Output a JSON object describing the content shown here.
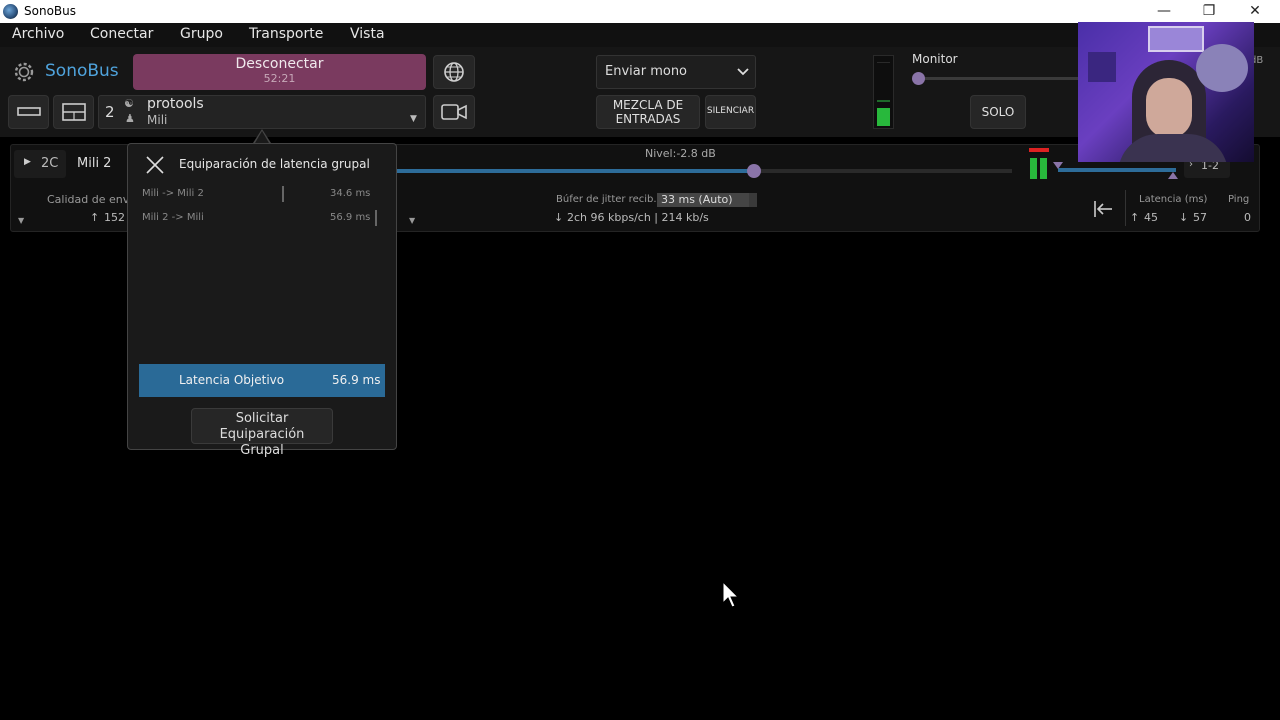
{
  "window": {
    "title": "SonoBus"
  },
  "menu": [
    "Archivo",
    "Conectar",
    "Grupo",
    "Transporte",
    "Vista"
  ],
  "toolbar": {
    "brand": "SonoBus",
    "disconnect_label": "Desconectar",
    "elapsed": "52:21",
    "group_count": "2",
    "group_name": "protools",
    "user_name": "Mili",
    "send_mode": "Enviar mono",
    "mix_inputs_line1": "MEZCLA DE",
    "mix_inputs_line2": "ENTRADAS",
    "mute_label": "SILENCIAR",
    "monitor_label": "Monitor",
    "solo_label": "SOLO",
    "db_partial": "dB"
  },
  "strip": {
    "channels": "2C",
    "peer_name": "Mili 2",
    "level_label": "Nivel:-2.8 dB",
    "level_fraction": 0.58,
    "output_label": "1-2",
    "send_quality_label": "Calidad de envi",
    "send_up": "152",
    "jitter_label": "Búfer de jitter recib.",
    "jitter_value": "33 ms (Auto)",
    "stream_info": "2ch 96 kbps/ch | 214 kb/s",
    "latency_label": "Latencia (ms)",
    "latency_up": "45",
    "latency_down": "57",
    "ping_label": "Ping",
    "ping_value": "0"
  },
  "popup": {
    "title": "Equiparación de latencia grupal",
    "rows": [
      {
        "label": "Mili -> Mili 2",
        "value": "34.6 ms"
      },
      {
        "label": "Mili 2 -> Mili",
        "value": "56.9 ms"
      }
    ],
    "target_label": "Latencia Objetivo",
    "target_value": "56.9 ms",
    "request_line1": "Solicitar Equiparación",
    "request_line2": "Grupal"
  }
}
